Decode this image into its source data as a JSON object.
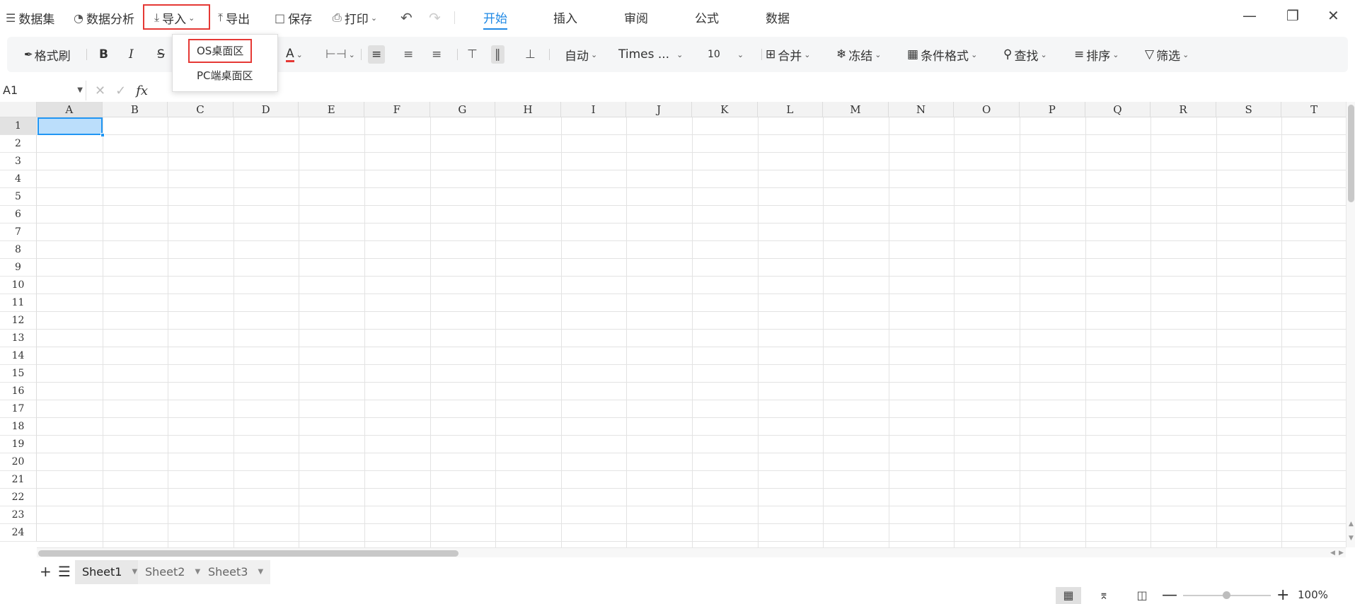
{
  "topbar": {
    "dataset": "数据集",
    "analysis": "数据分析",
    "import": "导入",
    "export": "导出",
    "save": "保存",
    "print": "打印",
    "tabs": [
      "开始",
      "插入",
      "审阅",
      "公式",
      "数据"
    ],
    "active_tab": "开始"
  },
  "import_menu": {
    "items": [
      "OS桌面区",
      "PC端桌面区"
    ]
  },
  "ribbon": {
    "format_painter": "格式刷",
    "bold": "B",
    "italic": "I",
    "strike": "S",
    "font_color": "A",
    "wrap_mode": "自动",
    "font_name": "Times ...",
    "font_size": "10",
    "merge": "合并",
    "freeze": "冻结",
    "conditional_format": "条件格式",
    "find": "查找",
    "sort": "排序",
    "filter": "筛选"
  },
  "formula_bar": {
    "cell_ref": "A1",
    "fx_label": "fx",
    "value": ""
  },
  "grid": {
    "columns": [
      "A",
      "B",
      "C",
      "D",
      "E",
      "F",
      "G",
      "H",
      "I",
      "J",
      "K",
      "L",
      "M",
      "N",
      "O",
      "P",
      "Q",
      "R",
      "S",
      "T"
    ],
    "rows": [
      "1",
      "2",
      "3",
      "4",
      "5",
      "6",
      "7",
      "8",
      "9",
      "10",
      "11",
      "12",
      "13",
      "14",
      "15",
      "16",
      "17",
      "18",
      "19",
      "20",
      "21",
      "22",
      "23",
      "24"
    ],
    "selected_cell": "A1"
  },
  "sheets": {
    "tabs": [
      "Sheet1",
      "Sheet2",
      "Sheet3"
    ],
    "active": "Sheet1"
  },
  "status": {
    "zoom": "100%"
  },
  "colors": {
    "accent": "#1e88e5",
    "highlight": "#e53935",
    "selection_fill": "#bbdefb"
  }
}
